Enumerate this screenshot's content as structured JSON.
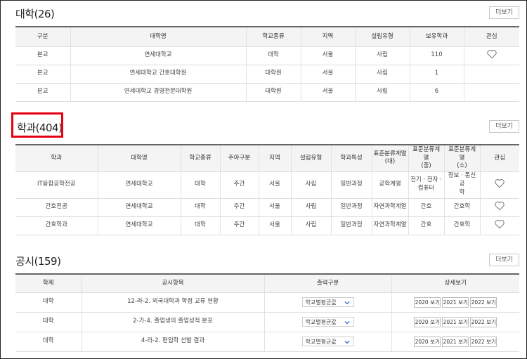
{
  "universities": {
    "title": "대학(26)",
    "more_label": "더보기",
    "headers": [
      "구분",
      "대학명",
      "학교종류",
      "지역",
      "설립유형",
      "보유학과",
      "관심"
    ],
    "rows": [
      [
        "본교",
        "연세대학교",
        "대학",
        "서울",
        "사립",
        "110"
      ],
      [
        "본교",
        "연세대학교 간호대학원",
        "대학원",
        "서울",
        "사립",
        "1"
      ],
      [
        "본교",
        "연세대학교 경영전문대학원",
        "대학원",
        "서울",
        "사립",
        "6"
      ]
    ]
  },
  "departments": {
    "title": "학과(404)",
    "more_label": "더보기",
    "headers": [
      "학과",
      "대학명",
      "학교종류",
      "주야구분",
      "지역",
      "설립유형",
      "학과특성",
      "표준분류계열\n(대)",
      "표준분류계열\n(중)",
      "표준분류계열\n(소)",
      "관심"
    ],
    "rows": [
      [
        "IT융합공학전공",
        "연세대학교",
        "대학",
        "주간",
        "서울",
        "사립",
        "일반과정",
        "공학계열",
        "전기 · 전자 ·\n컴퓨터",
        "정보 · 통신공\n학"
      ],
      [
        "간호전공",
        "연세대학교",
        "대학",
        "주간",
        "서울",
        "사립",
        "일반과정",
        "자연과학계열",
        "간호",
        "간호학"
      ],
      [
        "간호학과",
        "연세대학교",
        "대학",
        "주간",
        "서울",
        "사립",
        "일반과정",
        "자연과학계열",
        "간호",
        "간호학"
      ]
    ]
  },
  "disclosures": {
    "title": "공시(159)",
    "more_label": "더보기",
    "headers": [
      "학제",
      "공시항목",
      "출력구분",
      "상세보기"
    ],
    "rows": [
      {
        "type": "대학",
        "item": "12-라-2. 외국대학과 학점 교류 현황",
        "select": "학교별평균값",
        "years": [
          "2020 보기",
          "2021 보기",
          "2022 보기"
        ]
      },
      {
        "type": "대학",
        "item": "2-가-4. 졸업생의 졸업성적 분포",
        "select": "학교별평균값",
        "years": [
          "2020 보기",
          "2021 보기",
          "2022 보기"
        ]
      },
      {
        "type": "대학",
        "item": "4-라-2. 편입학 선발 결과",
        "select": "학교별평균값",
        "years": [
          "2020 보기",
          "2021 보기",
          "2022 보기"
        ]
      }
    ]
  },
  "colors": {
    "highlight": "#e60012",
    "header_bg": "#f4f4f4",
    "header_top_border": "#666666"
  },
  "icons": {
    "favorite": "heart-outline-icon",
    "dropdown": "chevron-down-icon"
  }
}
